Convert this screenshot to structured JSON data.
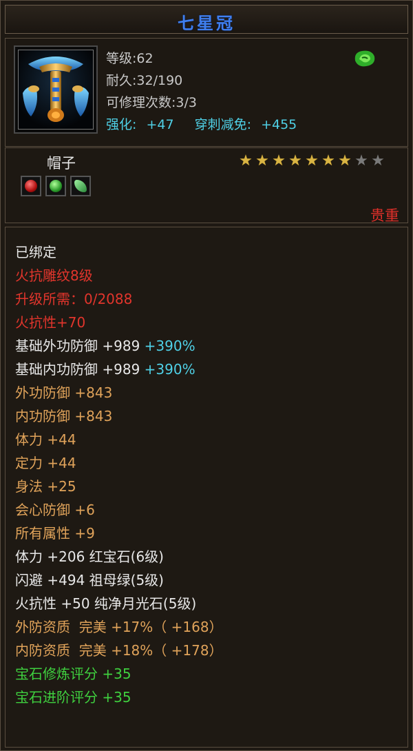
{
  "title": "七星冠",
  "header": {
    "icon": "crown-icon",
    "level": "等级:62",
    "durability": "耐久:32/190",
    "repairs": "可修理次数:3/3",
    "enhance_label": "强化:",
    "enhance_value": "+47",
    "pierce_label": "穿刺减免:",
    "pierce_value": "+455",
    "jade_icon": "jade-icon"
  },
  "mid": {
    "type": "帽子",
    "stars_filled": 7,
    "stars_total": 9,
    "gems": [
      "ruby-gem-icon",
      "emerald-gem-icon",
      "moonstone-gem-icon"
    ],
    "rarity": "贵重"
  },
  "properties": [
    {
      "text": "已绑定",
      "color": "white"
    },
    {
      "text": "火抗雕纹8级",
      "color": "red"
    },
    {
      "text": "升级所需：0/2088",
      "color": "red"
    },
    {
      "text": "火抗性+70",
      "color": "red"
    },
    {
      "text": "基础外功防御 +989",
      "extra": " +390%",
      "color": "white"
    },
    {
      "text": "基础内功防御 +989",
      "extra": " +390%",
      "color": "white"
    },
    {
      "text": "外功防御 +843",
      "color": "orange"
    },
    {
      "text": "内功防御 +843",
      "color": "orange"
    },
    {
      "text": "体力 +44",
      "color": "orange"
    },
    {
      "text": "定力 +44",
      "color": "orange"
    },
    {
      "text": "身法 +25",
      "color": "orange"
    },
    {
      "text": "会心防御 +6",
      "color": "orange"
    },
    {
      "text": "所有属性 +9",
      "color": "orange"
    },
    {
      "text": "体力 +206 红宝石(6级)",
      "color": "white"
    },
    {
      "text": "闪避 +494 祖母绿(5级)",
      "color": "white"
    },
    {
      "text": "火抗性 +50 纯净月光石(5级)",
      "color": "white"
    },
    {
      "text": "外防资质  完美 +17%（ +168）",
      "color": "orange"
    },
    {
      "text": "内防资质  完美 +18%（ +178）",
      "color": "orange"
    },
    {
      "text": "宝石修炼评分 +35",
      "color": "green"
    },
    {
      "text": "宝石进阶评分 +35",
      "color": "green"
    }
  ]
}
